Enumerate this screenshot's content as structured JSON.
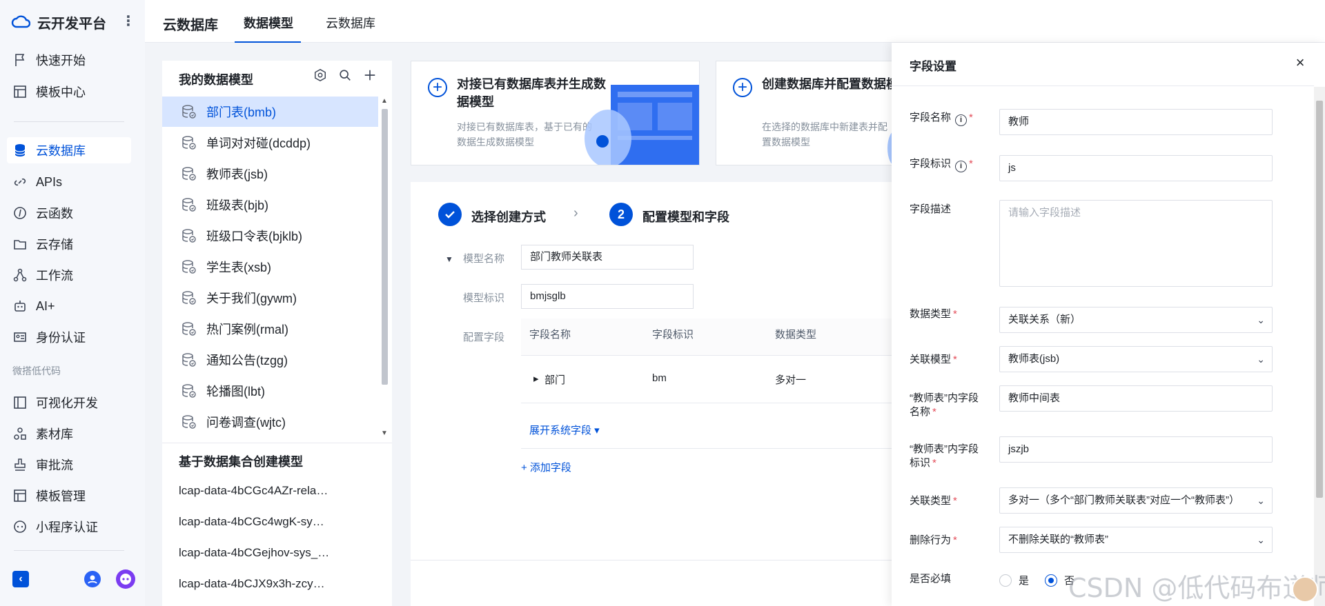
{
  "brand": {
    "name": "云开发平台"
  },
  "nav": {
    "items": [
      {
        "label": "快速开始",
        "icon": "flag-icon"
      },
      {
        "label": "模板中心",
        "icon": "template-icon"
      },
      {
        "label": "云数据库",
        "icon": "database-icon",
        "active": true
      },
      {
        "label": "APIs",
        "icon": "link-icon"
      },
      {
        "label": "云函数",
        "icon": "function-icon"
      },
      {
        "label": "云存储",
        "icon": "folder-icon"
      },
      {
        "label": "工作流",
        "icon": "workflow-icon"
      },
      {
        "label": "AI+",
        "icon": "robot-icon"
      },
      {
        "label": "身份认证",
        "icon": "id-card-icon"
      }
    ],
    "group_label": "微搭低代码",
    "lowcode_items": [
      {
        "label": "可视化开发",
        "icon": "layout-icon"
      },
      {
        "label": "素材库",
        "icon": "shapes-icon"
      },
      {
        "label": "审批流",
        "icon": "stamp-icon"
      },
      {
        "label": "模板管理",
        "icon": "template-icon"
      },
      {
        "label": "小程序认证",
        "icon": "mini-program-icon"
      }
    ]
  },
  "header": {
    "title": "云数据库",
    "tabs": [
      {
        "label": "数据模型",
        "active": true
      },
      {
        "label": "云数据库",
        "active": false
      }
    ]
  },
  "models": {
    "title": "我的数据模型",
    "items": [
      "部门表(bmb)",
      "单词对对碰(dcddp)",
      "教师表(jsb)",
      "班级表(bjb)",
      "班级口令表(bjklb)",
      "学生表(xsb)",
      "关于我们(gywm)",
      "热门案例(rmal)",
      "通知公告(tzgg)",
      "轮播图(lbt)",
      "问卷调查(wjtc)"
    ],
    "selected_index": 0,
    "set_title": "基于数据集合创建模型",
    "set_items": [
      "lcap-data-4bCGc4AZr-rela…",
      "lcap-data-4bCGc4wgK-sy…",
      "lcap-data-4bCGejhov-sys_…",
      "lcap-data-4bCJX9x3h-zcy…"
    ]
  },
  "cards": [
    {
      "title": "对接已有数据库表并生成数据模型",
      "desc": "对接已有数据库表，基于已有的数据生成数据模型"
    },
    {
      "title": "创建数据库并配置数据模",
      "desc": "在选择的数据库中新建表并配置数据模型"
    }
  ],
  "wizard": {
    "step1": "选择创建方式",
    "step2_num": "2",
    "step2": "配置模型和字段",
    "model_name_label": "模型名称",
    "model_name_value": "部门教师关联表",
    "model_id_label": "模型标识",
    "model_id_value": "bmjsglb",
    "config_label": "配置字段",
    "table_headers": [
      "字段名称",
      "字段标识",
      "数据类型"
    ],
    "rows": [
      {
        "name": "部门",
        "id": "bm",
        "type": "多对一"
      }
    ],
    "expand_link": "展开系统字段 ▾",
    "add_link": "+ 添加字段"
  },
  "drawer": {
    "title": "字段设置",
    "field_name_label": "字段名称",
    "field_name_value": "教师",
    "field_id_label": "字段标识",
    "field_id_value": "js",
    "desc_label": "字段描述",
    "desc_placeholder": "请输入字段描述",
    "type_label": "数据类型",
    "type_value": "关联关系（新）",
    "rel_model_label": "关联模型",
    "rel_model_value": "教师表(jsb)",
    "inner_name_label": "“教师表”内字段名称",
    "inner_name_value": "教师中间表",
    "inner_id_label": "“教师表”内字段标识",
    "inner_id_value": "jszjb",
    "rel_type_label": "关联类型",
    "rel_type_value": "多对一（多个“部门教师关联表”对应一个“教师表”）",
    "delete_label": "删除行为",
    "delete_value": "不删除关联的“教师表”",
    "required_label": "是否必填",
    "required_yes": "是",
    "required_no": "否"
  },
  "watermark": "CSDN @低代码布道师",
  "colors": {
    "accent": "#0052d9",
    "selected_bg": "#d7e5ff",
    "required": "#e34d59"
  }
}
